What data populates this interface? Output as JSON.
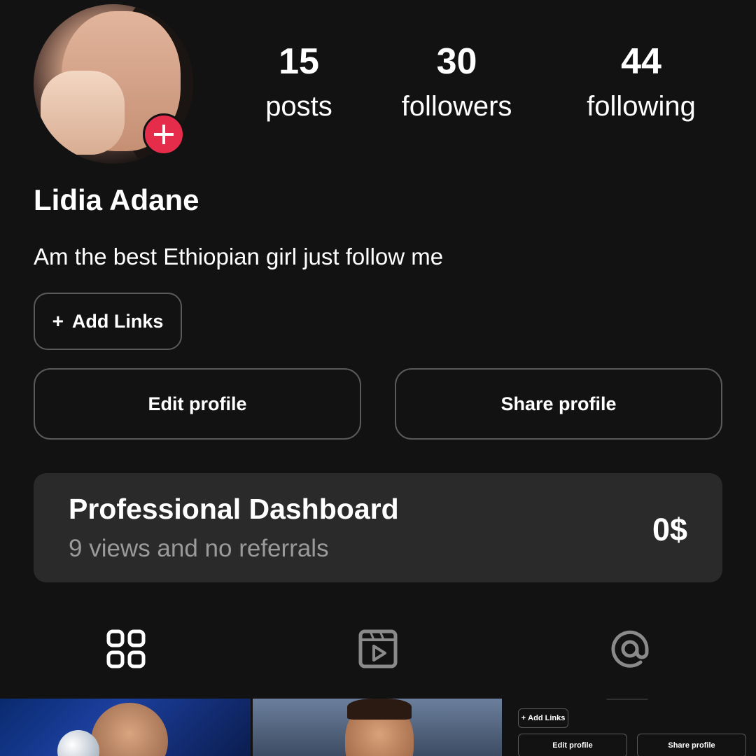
{
  "profile": {
    "name": "Lidia Adane",
    "bio": "Am the best Ethiopian girl just follow me",
    "stats": [
      {
        "value": "15",
        "label": "posts"
      },
      {
        "value": "30",
        "label": "followers"
      },
      {
        "value": "44",
        "label": "following"
      }
    ]
  },
  "buttons": {
    "add_links_icon": "+",
    "add_links": "Add Links",
    "edit_profile": "Edit profile",
    "share_profile": "Share profile"
  },
  "dashboard": {
    "title": "Professional Dashboard",
    "subtitle": "9 views and no referrals",
    "amount": "0$"
  },
  "tabs": [
    {
      "icon": "grid-icon",
      "selected": true
    },
    {
      "icon": "reels-icon",
      "selected": false
    },
    {
      "icon": "tagged-icon",
      "selected": false
    }
  ],
  "thumbnails": {
    "preview": {
      "add_links_icon": "+",
      "add_links": "Add Links",
      "edit_profile": "Edit profile",
      "share_profile": "Share profile"
    }
  },
  "colors": {
    "background": "#121212",
    "accent": "#e62c4b",
    "card": "#2a2a2a",
    "muted_text": "#9a9a9a"
  }
}
